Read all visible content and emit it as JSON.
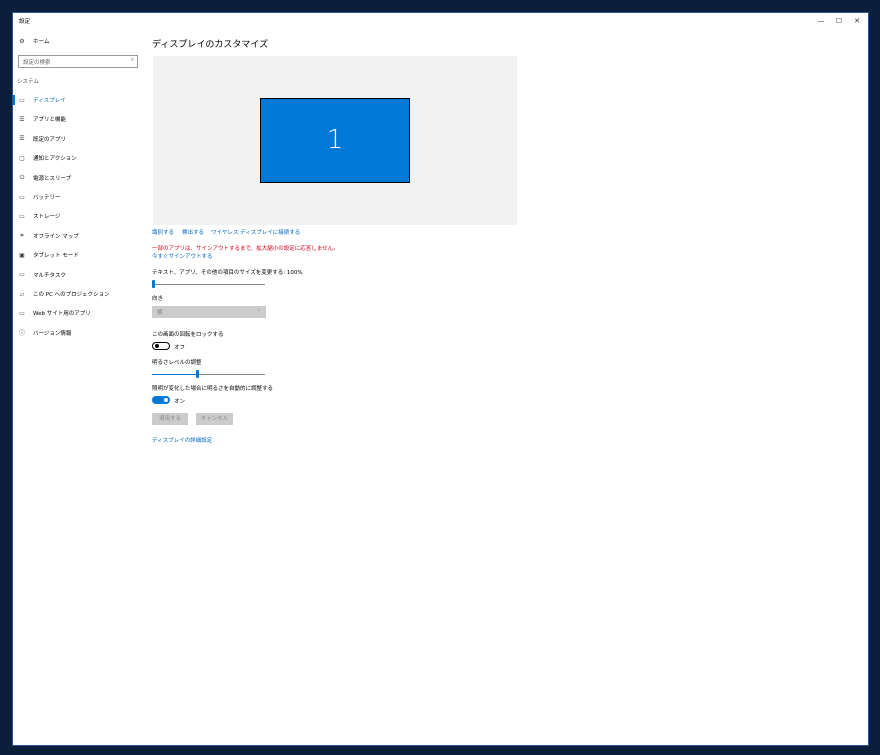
{
  "window": {
    "title": "設定",
    "minimize": "—",
    "maximize": "☐",
    "close": "✕"
  },
  "sidebar": {
    "home": "ホーム",
    "search_placeholder": "設定の検索",
    "section": "システム",
    "items": [
      {
        "label": "ディスプレイ",
        "icon": "monitor-icon",
        "glyph": "▭",
        "selected": true
      },
      {
        "label": "アプリと機能",
        "icon": "apps-list-icon",
        "glyph": "☰"
      },
      {
        "label": "既定のアプリ",
        "icon": "default-apps-icon",
        "glyph": "☰"
      },
      {
        "label": "通知とアクション",
        "icon": "notification-icon",
        "glyph": "▢"
      },
      {
        "label": "電源とスリープ",
        "icon": "power-icon",
        "glyph": "⏻"
      },
      {
        "label": "バッテリー",
        "icon": "battery-icon",
        "glyph": "▭"
      },
      {
        "label": "ストレージ",
        "icon": "storage-icon",
        "glyph": "▭"
      },
      {
        "label": "オフライン マップ",
        "icon": "map-icon",
        "glyph": "⌗"
      },
      {
        "label": "タブレット モード",
        "icon": "tablet-icon",
        "glyph": "▣"
      },
      {
        "label": "マルチタスク",
        "icon": "multitask-icon",
        "glyph": "▭"
      },
      {
        "label": "この PC へのプロジェクション",
        "icon": "projection-icon",
        "glyph": "▱"
      },
      {
        "label": "Web サイト用のアプリ",
        "icon": "web-apps-icon",
        "glyph": "▭"
      },
      {
        "label": "バージョン情報",
        "icon": "info-icon",
        "glyph": "ⓘ"
      }
    ]
  },
  "main": {
    "title": "ディスプレイのカスタマイズ",
    "monitor_number": "1",
    "links": {
      "identify": "識別する",
      "detect": "検出する",
      "wireless": "ワイヤレス ディスプレイに接続する"
    },
    "warning": "一部のアプリは、サインアウトするまで、拡大縮小の設定に応答しません。",
    "signout": "今すぐサインアウトする",
    "scale_label": "テキスト、アプリ、その他の項目のサイズを変更する: 100%",
    "scale_fraction": 0,
    "orientation_label": "向き",
    "orientation_value": "横",
    "rotation_lock_label": "この画面の回転をロックする",
    "rotation_lock_state": "オフ",
    "brightness_label": "明るさレベルの調整",
    "brightness_fraction": 0.4,
    "auto_brightness_label": "照明が変化した場合に明るさを自動的に調整する",
    "auto_brightness_state": "オン",
    "apply": "適用する",
    "cancel": "キャンセル",
    "advanced": "ディスプレイの詳細設定"
  },
  "colors": {
    "accent": "#0078d7",
    "warning": "#d0021b"
  }
}
